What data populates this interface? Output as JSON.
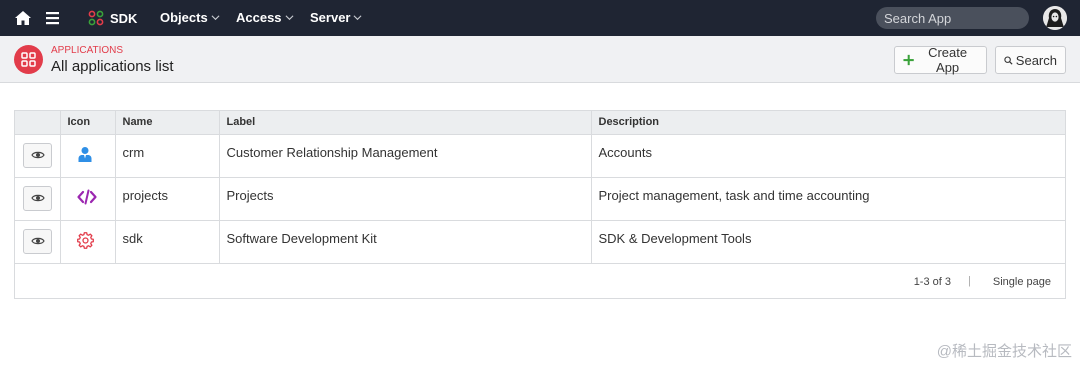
{
  "navbar": {
    "brand": "SDK",
    "menus": [
      {
        "label": "Objects"
      },
      {
        "label": "Access"
      },
      {
        "label": "Server"
      }
    ],
    "search_placeholder": "Search App"
  },
  "header": {
    "breadcrumb": "Applications",
    "title": "All applications list",
    "create_label": "Create App",
    "search_label": "Search"
  },
  "table": {
    "columns": [
      "",
      "Icon",
      "Name",
      "Label",
      "Description"
    ],
    "rows": [
      {
        "icon": "user-icon",
        "icon_color": "#2f8fe6",
        "name": "crm",
        "label": "Customer Relationship Management",
        "description": "Accounts"
      },
      {
        "icon": "code-icon",
        "icon_color": "#9b27b0",
        "name": "projects",
        "label": "Projects",
        "description": "Project management, task and time accounting"
      },
      {
        "icon": "gear-icon",
        "icon_color": "#e23c4a",
        "name": "sdk",
        "label": "Software Development Kit",
        "description": "SDK & Development Tools"
      }
    ]
  },
  "pager": {
    "count": "1-3 of 3",
    "separator": "|",
    "mode": "Single page"
  },
  "watermark": "@稀土掘金技术社区",
  "colors": {
    "accent": "#e23c4a",
    "navbar": "#1f2533",
    "create_plus": "#3aa23a"
  }
}
